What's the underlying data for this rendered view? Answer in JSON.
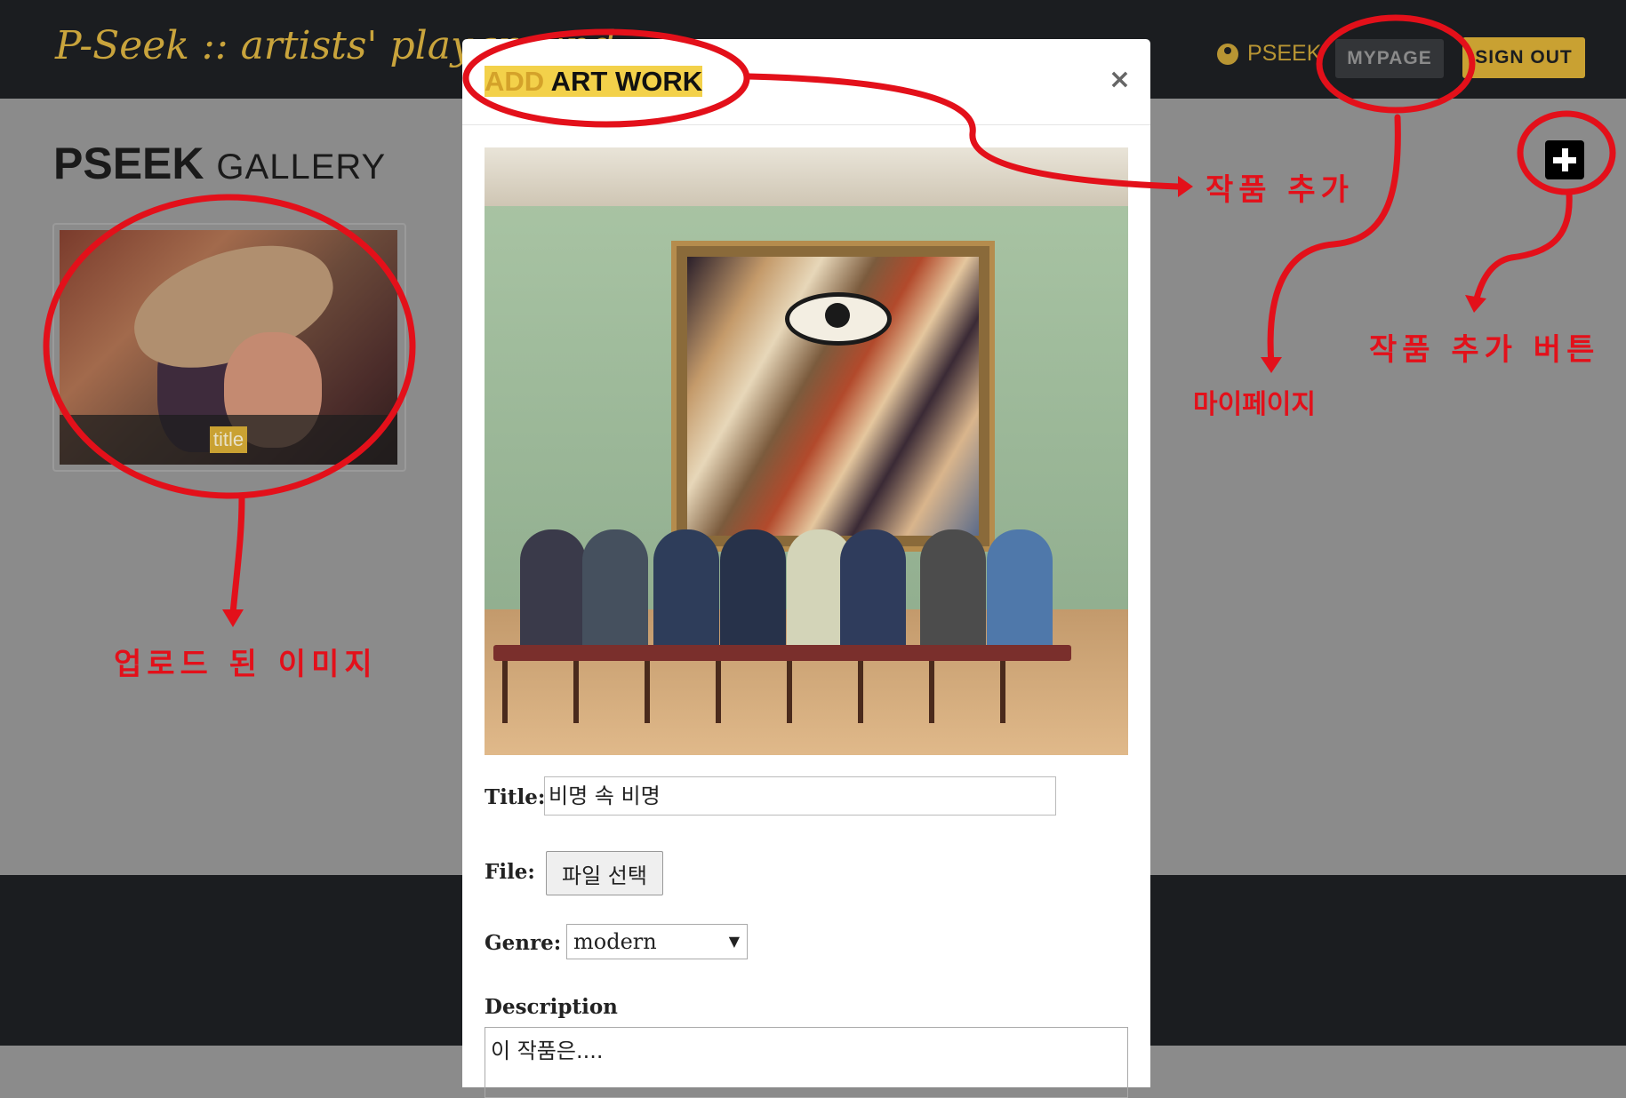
{
  "app": {
    "brand": "P-Seek :: artists' playground",
    "user_label": "PSEEK",
    "mypage_label": "MYPAGE",
    "signout_label": "SIGN OUT"
  },
  "gallery": {
    "title_bold": "PSEEK",
    "title_light": "GALLERY",
    "card_caption": "title"
  },
  "modal": {
    "title_hl": "ADD",
    "title_rest": " ART WORK",
    "close_label": "×",
    "form": {
      "title_label": "Title:",
      "title_value": "비명 속 비명",
      "file_label": "File:",
      "file_button": "파일 선택",
      "genre_label": "Genre:",
      "genre_value": "modern",
      "description_label": "Description",
      "description_value": "이 작품은...."
    }
  },
  "annotations": {
    "add_artwork": "작품 추가",
    "mypage": "마이페이지",
    "add_button": "작품 추가 버튼",
    "uploaded_image": "업로드 된 이미지"
  },
  "colors": {
    "accent_gold": "#c9a132",
    "annotation_red": "#e3101a",
    "nav_dark": "#1b1d20"
  }
}
